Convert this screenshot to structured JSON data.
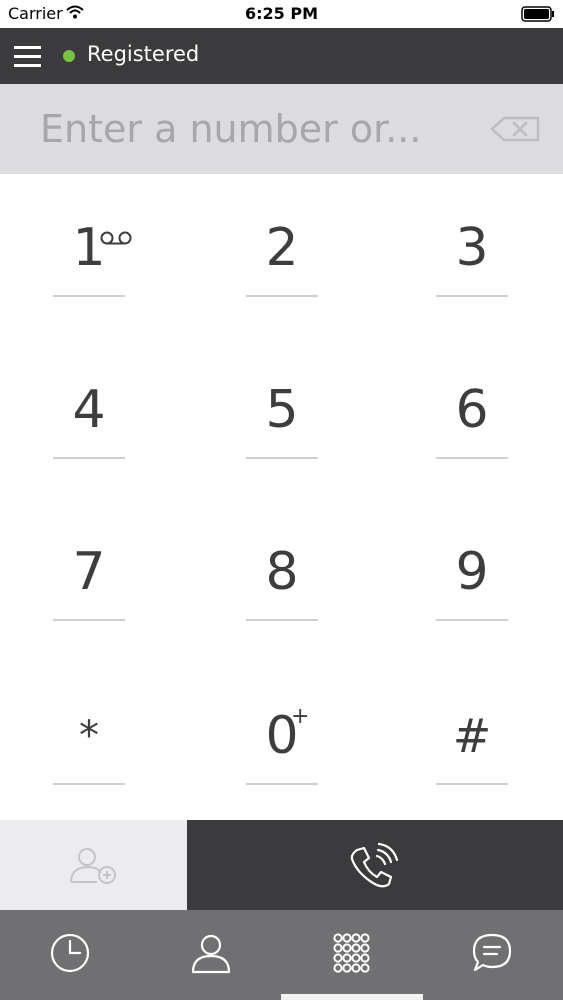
{
  "status_bar": {
    "carrier": "Carrier",
    "time": "6:25 PM",
    "wifi_icon": "wifi-icon",
    "battery_icon": "battery-icon"
  },
  "header": {
    "menu_icon": "hamburger-menu-icon",
    "status_text": "Registered",
    "status_color": "#7cc242"
  },
  "number_entry": {
    "placeholder": "Enter a number or...",
    "value": "",
    "backspace_icon": "backspace-icon"
  },
  "keypad": {
    "keys": [
      {
        "digit": "1",
        "sub": "voicemail-icon"
      },
      {
        "digit": "2",
        "sub": ""
      },
      {
        "digit": "3",
        "sub": ""
      },
      {
        "digit": "4",
        "sub": ""
      },
      {
        "digit": "5",
        "sub": ""
      },
      {
        "digit": "6",
        "sub": ""
      },
      {
        "digit": "7",
        "sub": ""
      },
      {
        "digit": "8",
        "sub": ""
      },
      {
        "digit": "9",
        "sub": ""
      },
      {
        "digit": "*",
        "sub": ""
      },
      {
        "digit": "0",
        "sub": "+"
      },
      {
        "digit": "#",
        "sub": ""
      }
    ]
  },
  "action_bar": {
    "add_contact_icon": "add-contact-icon",
    "call_icon": "phone-call-icon"
  },
  "tab_bar": {
    "tabs": [
      {
        "icon": "clock-icon",
        "name": "recents"
      },
      {
        "icon": "person-icon",
        "name": "contacts"
      },
      {
        "icon": "keypad-icon",
        "name": "keypad"
      },
      {
        "icon": "chat-icon",
        "name": "messages"
      }
    ]
  },
  "colors": {
    "header_bg": "#3b3b3d",
    "entry_bg": "#dcdcde",
    "tab_bar_bg": "#707072",
    "accent_green": "#7cc242"
  }
}
